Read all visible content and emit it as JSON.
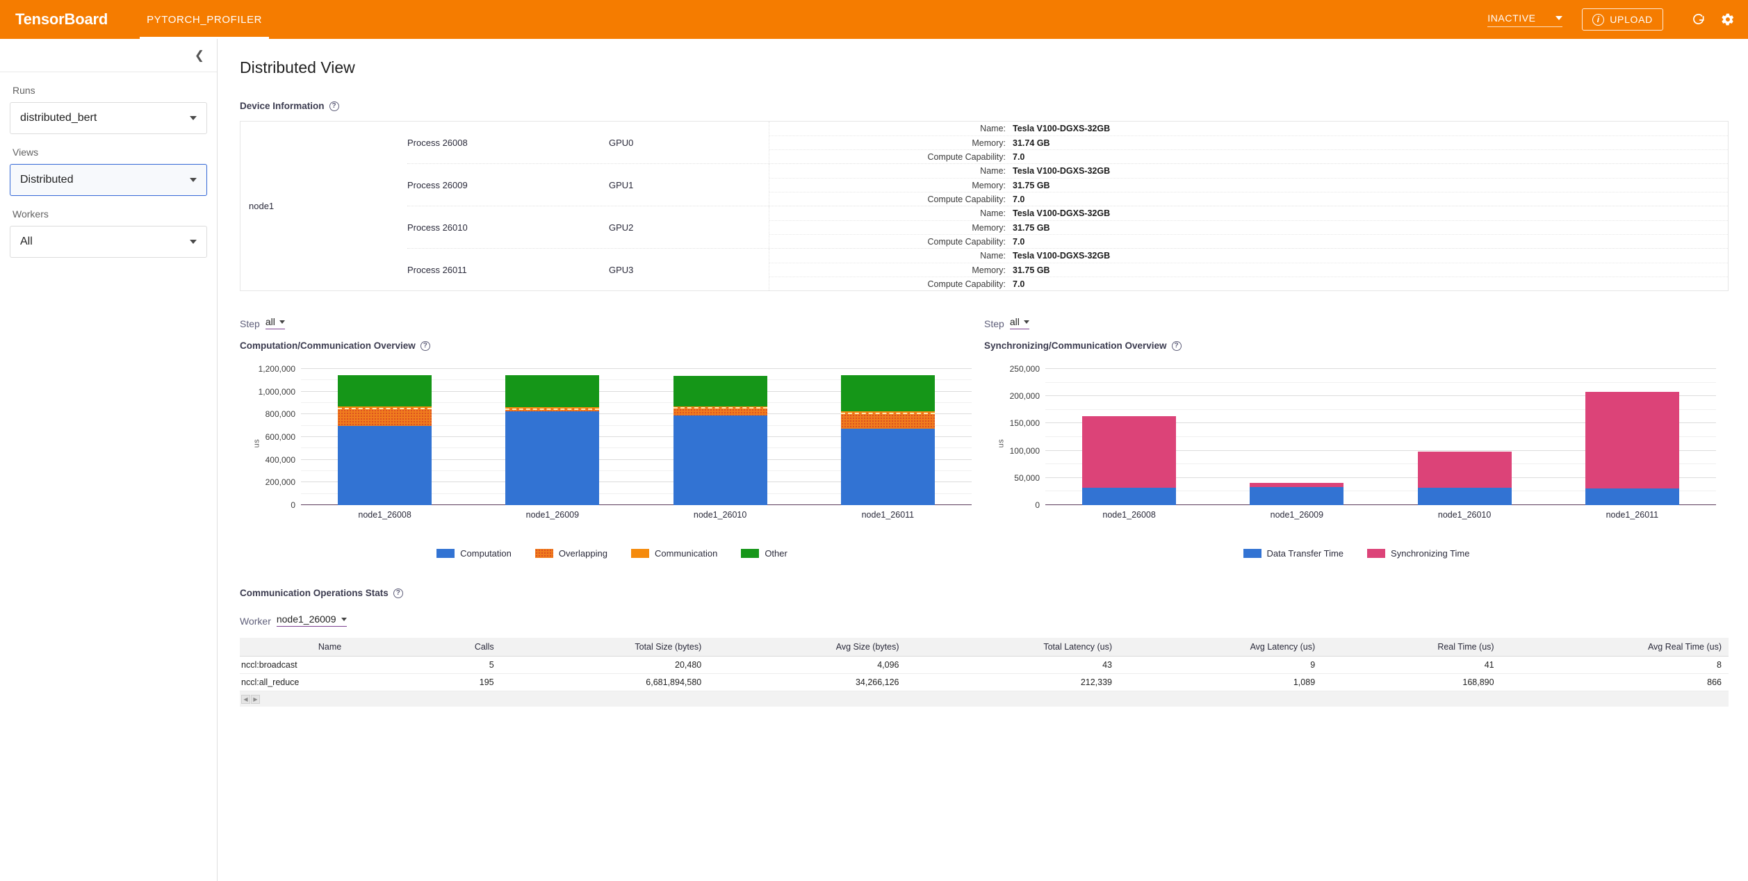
{
  "header": {
    "logo": "TensorBoard",
    "tabs": [
      {
        "label": "PYTORCH_PROFILER",
        "active": true
      }
    ],
    "status_select": "INACTIVE",
    "upload_label": "UPLOAD",
    "icons": [
      "info-circle-icon",
      "refresh-icon",
      "gear-icon"
    ]
  },
  "sidebar": {
    "collapse_icon": "chevron-left-icon",
    "runs_label": "Runs",
    "runs_value": "distributed_bert",
    "views_label": "Views",
    "views_value": "Distributed",
    "workers_label": "Workers",
    "workers_value": "All"
  },
  "main": {
    "page_title": "Distributed View",
    "device_information": {
      "title": "Device Information",
      "node": "node1",
      "rows": [
        {
          "process": "Process 26008",
          "gpu": "GPU0",
          "kv": [
            {
              "k": "Name:",
              "v": "Tesla V100-DGXS-32GB"
            },
            {
              "k": "Memory:",
              "v": "31.74 GB"
            },
            {
              "k": "Compute Capability:",
              "v": "7.0"
            }
          ]
        },
        {
          "process": "Process 26009",
          "gpu": "GPU1",
          "kv": [
            {
              "k": "Name:",
              "v": "Tesla V100-DGXS-32GB"
            },
            {
              "k": "Memory:",
              "v": "31.75 GB"
            },
            {
              "k": "Compute Capability:",
              "v": "7.0"
            }
          ]
        },
        {
          "process": "Process 26010",
          "gpu": "GPU2",
          "kv": [
            {
              "k": "Name:",
              "v": "Tesla V100-DGXS-32GB"
            },
            {
              "k": "Memory:",
              "v": "31.75 GB"
            },
            {
              "k": "Compute Capability:",
              "v": "7.0"
            }
          ]
        },
        {
          "process": "Process 26011",
          "gpu": "GPU3",
          "kv": [
            {
              "k": "Name:",
              "v": "Tesla V100-DGXS-32GB"
            },
            {
              "k": "Memory:",
              "v": "31.75 GB"
            },
            {
              "k": "Compute Capability:",
              "v": "7.0"
            }
          ]
        }
      ]
    },
    "left_chart_step": {
      "label": "Step",
      "value": "all"
    },
    "right_chart_step": {
      "label": "Step",
      "value": "all"
    },
    "comm_ops": {
      "title": "Communication Operations Stats",
      "worker_label": "Worker",
      "worker_value": "node1_26009",
      "columns": [
        "Name",
        "Calls",
        "Total Size (bytes)",
        "Avg Size (bytes)",
        "Total Latency (us)",
        "Avg Latency (us)",
        "Real Time (us)",
        "Avg Real Time (us)"
      ],
      "rows": [
        [
          "nccl:broadcast",
          "5",
          "20,480",
          "4,096",
          "43",
          "9",
          "41",
          "8"
        ],
        [
          "nccl:all_reduce",
          "195",
          "6,681,894,580",
          "34,266,126",
          "212,339",
          "1,089",
          "168,890",
          "866"
        ]
      ],
      "pager": {
        "prev": "◀",
        "next": "▶"
      }
    }
  },
  "colors": {
    "brand_orange": "#f57c00",
    "computation_blue": "#3273d3",
    "overlapping_orange": "#f07c1e",
    "communication_orange": "#f58a0b",
    "other_green": "#159618",
    "data_transfer_blue": "#3273d3",
    "synchronizing_pink": "#dc4378"
  },
  "chart_data": [
    {
      "type": "bar",
      "stacked": true,
      "title": "Computation/Communication Overview",
      "xlabel": "",
      "ylabel": "us",
      "ylim": [
        0,
        1200000
      ],
      "yticks": [
        0,
        200000,
        400000,
        600000,
        800000,
        1000000,
        1200000
      ],
      "ytick_labels": [
        "0",
        "200,000",
        "400,000",
        "600,000",
        "800,000",
        "1,000,000",
        "1,200,000"
      ],
      "categories": [
        "node1_26008",
        "node1_26009",
        "node1_26010",
        "node1_26011"
      ],
      "legend_position": "bottom",
      "grid": true,
      "series": [
        {
          "name": "Computation",
          "color": "#3273d3",
          "values": [
            701000,
            827000,
            790000,
            673000
          ]
        },
        {
          "name": "Overlapping",
          "color": "#f07c1e",
          "values": [
            157000,
            25000,
            71000,
            142000
          ]
        },
        {
          "name": "Communication",
          "color": "#f58a0b",
          "values": [
            10000,
            14000,
            9000,
            10000
          ]
        },
        {
          "name": "Other",
          "color": "#159618",
          "values": [
            277000,
            279000,
            269000,
            318000
          ]
        }
      ]
    },
    {
      "type": "bar",
      "stacked": true,
      "title": "Synchronizing/Communication Overview",
      "xlabel": "",
      "ylabel": "us",
      "ylim": [
        0,
        250000
      ],
      "yticks": [
        0,
        50000,
        100000,
        150000,
        200000,
        250000
      ],
      "ytick_labels": [
        "0",
        "50,000",
        "100,000",
        "150,000",
        "200,000",
        "250,000"
      ],
      "categories": [
        "node1_26008",
        "node1_26009",
        "node1_26010",
        "node1_26011"
      ],
      "legend_position": "bottom",
      "grid": true,
      "series": [
        {
          "name": "Data Transfer Time",
          "color": "#3273d3",
          "values": [
            32000,
            33000,
            32000,
            31000
          ]
        },
        {
          "name": "Synchronizing Time",
          "color": "#dc4378",
          "values": [
            131000,
            8000,
            66000,
            177000
          ]
        }
      ]
    }
  ]
}
